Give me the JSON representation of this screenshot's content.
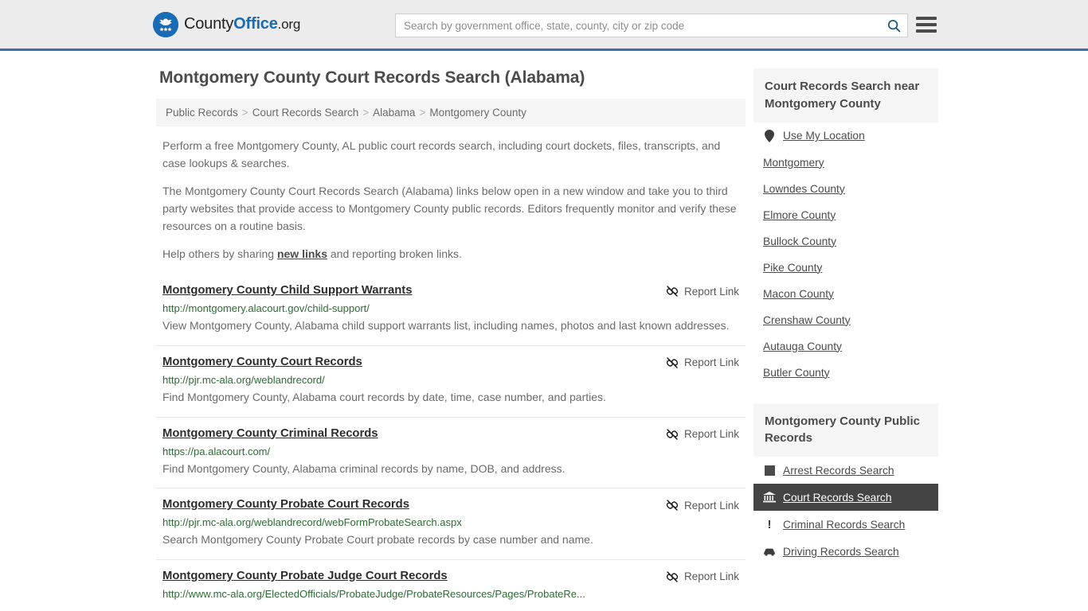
{
  "header": {
    "logo": {
      "part1": "County",
      "part2": "Office",
      "part3": ".org",
      "emblem_color": "#1a6bb5"
    },
    "search": {
      "placeholder": "Search by government office, state, county, city or zip code",
      "value": "",
      "icon": "search-icon"
    },
    "menu_icon": "hamburger-menu-icon",
    "accent_color": "#3a6ea5",
    "background_color": "#ececec"
  },
  "page": {
    "title": "Montgomery County Court Records Search (Alabama)"
  },
  "breadcrumb": {
    "separator": ">",
    "items": [
      {
        "label": "Public Records"
      },
      {
        "label": "Court Records Search"
      },
      {
        "label": "Alabama"
      },
      {
        "label": "Montgomery County"
      }
    ]
  },
  "intro": {
    "paragraph1": "Perform a free Montgomery County, AL public court records search, including court dockets, files, transcripts, and case lookups & searches.",
    "paragraph2": "The Montgomery County Court Records Search (Alabama) links below open in a new window and take you to third party websites that provide access to Montgomery County public records. Editors frequently monitor and verify these resources on a routine basis.",
    "paragraph3_before": "Help others by sharing ",
    "paragraph3_link": "new links",
    "paragraph3_after": " and reporting broken links."
  },
  "results": {
    "report_label": "Report Link",
    "report_icon": "broken-link-icon",
    "items": [
      {
        "title": "Montgomery County Child Support Warrants",
        "url": "http://montgomery.alacourt.gov/child-support/",
        "description": "View Montgomery County, Alabama child support warrants list, including names, photos and last known addresses."
      },
      {
        "title": "Montgomery County Court Records",
        "url": "http://pjr.mc-ala.org/weblandrecord/",
        "description": "Find Montgomery County, Alabama court records by date, time, case number, and parties."
      },
      {
        "title": "Montgomery County Criminal Records",
        "url": "https://pa.alacourt.com/",
        "description": "Find Montgomery County, Alabama criminal records by name, DOB, and address."
      },
      {
        "title": "Montgomery County Probate Court Records",
        "url": "http://pjr.mc-ala.org/weblandrecord/webFormProbateSearch.aspx",
        "description": "Search Montgomery County Probate Court probate records by case number and name."
      },
      {
        "title": "Montgomery County Probate Judge Court Records",
        "url": "http://www.mc-ala.org/ElectedOfficials/ProbateJudge/ProbateResources/Pages/ProbateRe...",
        "description": ""
      }
    ]
  },
  "sidebar": {
    "nearby": {
      "title": "Court Records Search near Montgomery County",
      "items": [
        {
          "label": "Use My Location",
          "icon": "map-pin-icon"
        },
        {
          "label": "Montgomery",
          "icon": ""
        },
        {
          "label": "Lowndes County",
          "icon": ""
        },
        {
          "label": "Elmore County",
          "icon": ""
        },
        {
          "label": "Bullock County",
          "icon": ""
        },
        {
          "label": "Pike County",
          "icon": ""
        },
        {
          "label": "Macon County",
          "icon": ""
        },
        {
          "label": "Crenshaw County",
          "icon": ""
        },
        {
          "label": "Autauga County",
          "icon": ""
        },
        {
          "label": "Butler County",
          "icon": ""
        }
      ]
    },
    "public_records": {
      "title": "Montgomery County Public Records",
      "items": [
        {
          "label": "Arrest Records Search",
          "icon": "square-icon",
          "active": false
        },
        {
          "label": "Court Records Search",
          "icon": "courthouse-icon",
          "active": true
        },
        {
          "label": "Criminal Records Search",
          "icon": "exclamation-icon",
          "active": false
        },
        {
          "label": "Driving Records Search",
          "icon": "car-icon",
          "active": false
        }
      ]
    }
  }
}
